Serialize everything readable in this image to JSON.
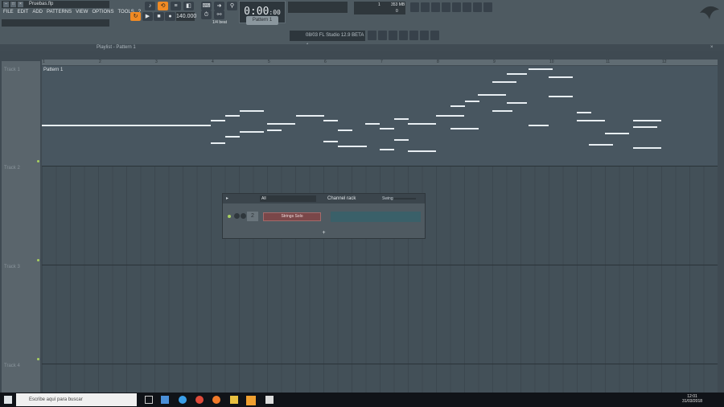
{
  "window": {
    "title": "Pruebas.flp",
    "menu": [
      "FILE",
      "EDIT",
      "ADD",
      "PATTERNS",
      "VIEW",
      "OPTIONS",
      "TOOLS",
      "?"
    ]
  },
  "transport": {
    "tempo": "140.000",
    "time": "0:00",
    "time_small": ":00",
    "time_unit": "M:S:CS",
    "pattern": "Pattern 1",
    "snap": "1/4 beat"
  },
  "cpu": {
    "voices": "1",
    "memory": "353 MB",
    "value2": "0"
  },
  "hint": {
    "text": "FL Studio 12.9 BETA 4",
    "prefix": "08/03"
  },
  "playlist": {
    "title": "Playlist - Pattern 1",
    "pattern_clip": "Pattern 1",
    "tracks": [
      "Track 1",
      "Track 2",
      "Track 3",
      "Track 4"
    ],
    "bars": [
      "1",
      "2",
      "3",
      "4",
      "5",
      "6",
      "7",
      "8",
      "9",
      "10",
      "11",
      "12"
    ]
  },
  "channel_rack": {
    "filter": "All",
    "title": "Channel rack",
    "swing": "Swing",
    "channel_num": "2",
    "channel_name": "Strings Solo",
    "add": "+"
  },
  "taskbar": {
    "search": "Escribe aquí para buscar",
    "time": "12:01",
    "date": "31/03/2018"
  },
  "colors": {
    "accent": "#f08a24",
    "background": "#3f4a52",
    "channel": "#7a4749"
  }
}
